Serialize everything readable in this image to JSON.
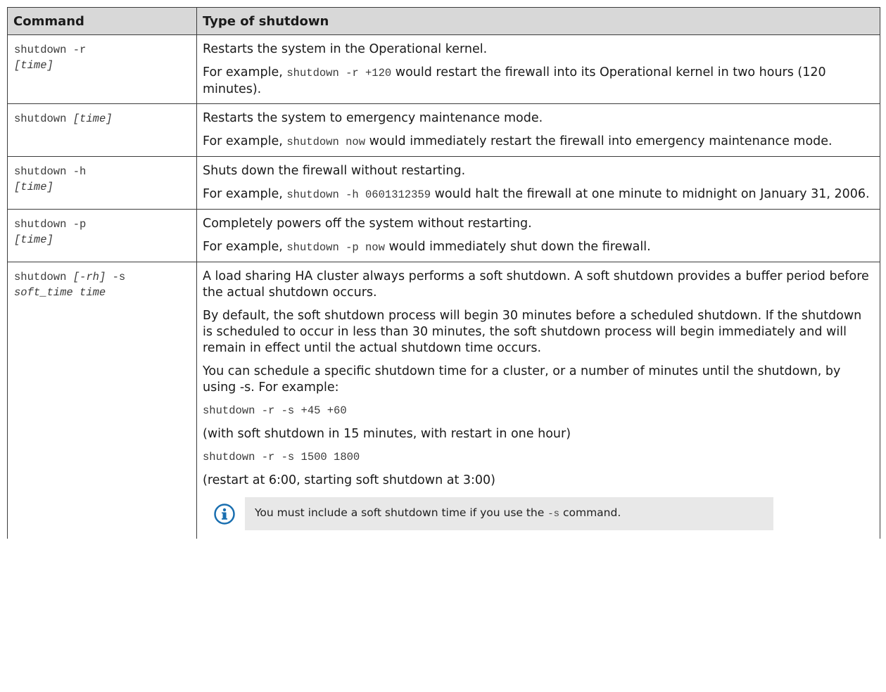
{
  "headers": {
    "command": "Command",
    "type": "Type of shutdown"
  },
  "rows": [
    {
      "cmd_prefix": "shutdown -r",
      "cmd_arg": "[time]",
      "line1": "Restarts the system in the Operational kernel.",
      "example_pre": "For example,",
      "example_code": "shutdown -r +120",
      "example_post": "would restart the firewall into its Operational kernel in two hours (120 minutes)."
    },
    {
      "cmd_prefix": "shutdown",
      "cmd_arg": "[time]",
      "line1": "Restarts the system to emergency maintenance mode.",
      "example_pre": "For example,",
      "example_code": "shutdown now",
      "example_post": "would immediately restart the firewall into emergency maintenance mode."
    },
    {
      "cmd_prefix": "shutdown -h",
      "cmd_arg": "[time]",
      "line1": "Shuts down the firewall without restarting.",
      "example_pre": "For example,",
      "example_code": "shutdown -h 0601312359",
      "example_post": "would halt the firewall at one minute to midnight on January 31, 2006."
    },
    {
      "cmd_prefix": "shutdown -p",
      "cmd_arg": "[time]",
      "line1": "Completely powers off the system without restarting.",
      "example_pre": "For example,",
      "example_code": "shutdown -p now",
      "example_post": "would immediately shut down the firewall."
    }
  ],
  "last_row": {
    "cmd_prefix": "shutdown",
    "cmd_opt": "[-rh]",
    "cmd_flag": "-s",
    "cmd_args": "soft_time time",
    "para1": "A load sharing HA cluster always performs a soft shutdown. A soft shutdown provides a buffer period before the actual shutdown occurs.",
    "para2": "By default, the soft shutdown process will begin 30 minutes before a scheduled shutdown. If the shutdown is scheduled to occur in less than 30 minutes, the soft shutdown process will begin immediately and will remain in effect until the actual shutdown time occurs.",
    "para3": "You can schedule a specific shutdown time for a cluster, or a number of minutes until the shutdown, by using -s. For example:",
    "code1": "shutdown -r -s +45 +60",
    "note1": "(with soft shutdown in 15 minutes, with restart in one hour)",
    "code2": "shutdown -r -s 1500 1800",
    "note2": "(restart at 6:00, starting soft shutdown at 3:00)",
    "info_pre": "You must include a soft shutdown time if you use the",
    "info_code": "-s",
    "info_post": "command."
  },
  "colors": {
    "header_bg": "#d8d8d8",
    "border": "#3c3c3c",
    "note_bg": "#e8e8e8",
    "info_icon": "#1a6fb0"
  }
}
